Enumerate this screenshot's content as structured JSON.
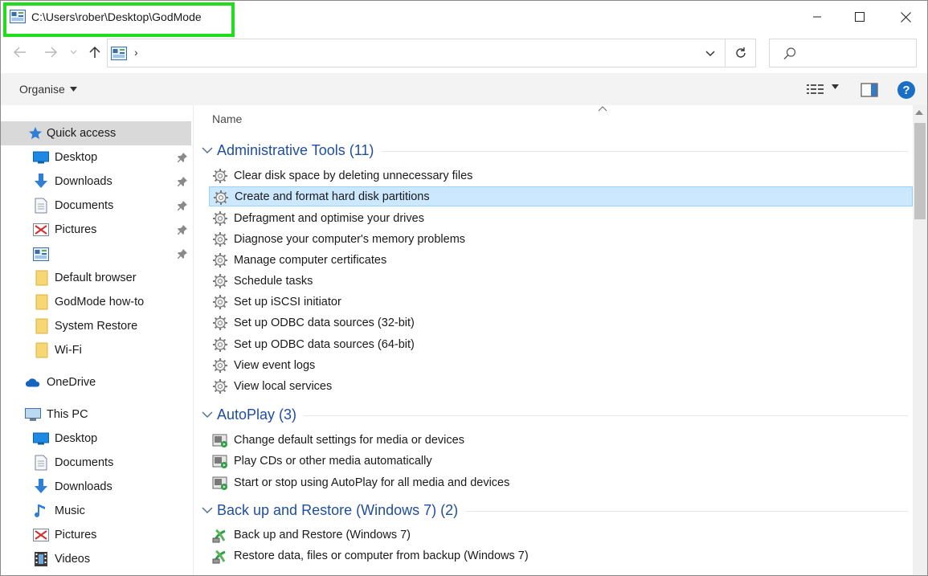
{
  "window": {
    "title": "C:\\Users\\rober\\Desktop\\GodMode",
    "minimize": "—",
    "maximize": "☐",
    "close": "✕"
  },
  "address": {
    "separator": "›",
    "search_placeholder": ""
  },
  "toolbar": {
    "organise_label": "Organise"
  },
  "nav": {
    "quick_access": "Quick access",
    "quick_items": [
      {
        "label": "Desktop",
        "icon": "desktop-icon",
        "pinned": true
      },
      {
        "label": "Downloads",
        "icon": "download-arrow-icon",
        "pinned": true
      },
      {
        "label": "Documents",
        "icon": "document-icon",
        "pinned": true
      },
      {
        "label": "Pictures",
        "icon": "pictures-icon",
        "pinned": true
      },
      {
        "label": "",
        "icon": "control-panel-icon",
        "pinned": true
      },
      {
        "label": "Default browser",
        "icon": "folder-icon",
        "pinned": false
      },
      {
        "label": "GodMode how-to",
        "icon": "folder-icon",
        "pinned": false
      },
      {
        "label": "System Restore",
        "icon": "folder-icon",
        "pinned": false
      },
      {
        "label": "Wi-Fi",
        "icon": "folder-icon",
        "pinned": false
      }
    ],
    "onedrive": "OneDrive",
    "this_pc": "This PC",
    "pc_items": [
      {
        "label": "Desktop",
        "icon": "desktop-icon"
      },
      {
        "label": "Documents",
        "icon": "document-icon"
      },
      {
        "label": "Downloads",
        "icon": "download-arrow-icon"
      },
      {
        "label": "Music",
        "icon": "music-note-icon"
      },
      {
        "label": "Pictures",
        "icon": "pictures-icon"
      },
      {
        "label": "Videos",
        "icon": "video-icon"
      }
    ]
  },
  "content": {
    "column_name": "Name",
    "groups": [
      {
        "title": "Administrative Tools (11)",
        "items": [
          "Clear disk space by deleting unnecessary files",
          "Create and format hard disk partitions",
          "Defragment and optimise your drives",
          "Diagnose your computer's memory problems",
          "Manage computer certificates",
          "Schedule tasks",
          "Set up iSCSI initiator",
          "Set up ODBC data sources (32-bit)",
          "Set up ODBC data sources (64-bit)",
          "View event logs",
          "View local services"
        ]
      },
      {
        "title": "AutoPlay (3)",
        "items": [
          "Change default settings for media or devices",
          "Play CDs or other media automatically",
          "Start or stop using AutoPlay for all media and devices"
        ]
      },
      {
        "title": "Back up and Restore (Windows 7) (2)",
        "items": [
          "Back up and Restore (Windows 7)",
          "Restore data, files or computer from backup (Windows 7)"
        ]
      }
    ]
  },
  "colors": {
    "title_highlight": "#22dd1a",
    "group_title": "#1f4e9e",
    "selection_bg": "#cce8ff",
    "selection_border": "#99d1ff",
    "nav_selected": "#d9d9d9",
    "help_blue": "#1a6fc4"
  }
}
